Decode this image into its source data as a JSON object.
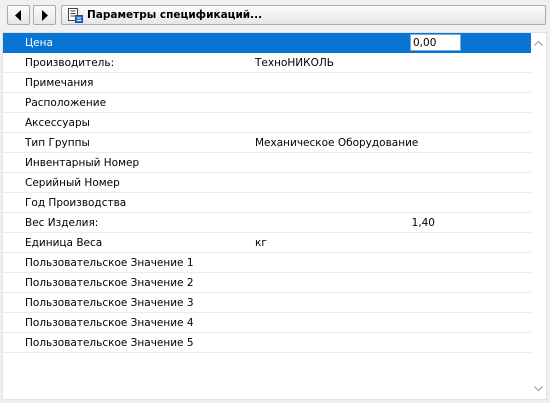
{
  "toolbar": {
    "title": "Параметры спецификаций..."
  },
  "properties": {
    "rows": [
      {
        "label": "Цена",
        "value": "0,00"
      },
      {
        "label": "Производитель:",
        "value": "ТехноНИКОЛЬ"
      },
      {
        "label": "Примечания",
        "value": ""
      },
      {
        "label": "Расположение",
        "value": ""
      },
      {
        "label": "Аксессуары",
        "value": ""
      },
      {
        "label": "Тип Группы",
        "value": "Механическое Оборудование"
      },
      {
        "label": "Инвентарный Номер",
        "value": ""
      },
      {
        "label": "Серийный Номер",
        "value": ""
      },
      {
        "label": "Год Производства",
        "value": ""
      },
      {
        "label": "Вес Изделия:",
        "value": "1,40"
      },
      {
        "label": "Единица Веса",
        "value": "кг"
      },
      {
        "label": "Пользовательское Значение 1",
        "value": ""
      },
      {
        "label": "Пользовательское Значение 2",
        "value": ""
      },
      {
        "label": "Пользовательское Значение 3",
        "value": ""
      },
      {
        "label": "Пользовательское Значение 4",
        "value": ""
      },
      {
        "label": "Пользовательское Значение 5",
        "value": ""
      }
    ]
  },
  "icons": {
    "back": "chevron-left-icon",
    "forward": "chevron-right-icon",
    "title": "document-settings-icon"
  },
  "colors": {
    "selection": "#0a74d4"
  }
}
